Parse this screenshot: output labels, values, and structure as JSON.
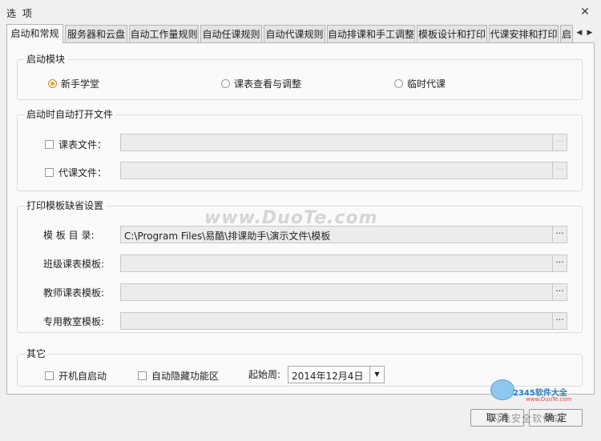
{
  "window": {
    "title": "选 项"
  },
  "tabs": [
    {
      "label": "启动和常规"
    },
    {
      "label": "服务器和云盘"
    },
    {
      "label": "自动工作量规则"
    },
    {
      "label": "自动任课规则"
    },
    {
      "label": "自动代课规则"
    },
    {
      "label": "自动排课和手工调整"
    },
    {
      "label": "模板设计和打印"
    },
    {
      "label": "代课安排和打印"
    },
    {
      "label": "启"
    }
  ],
  "startup": {
    "title": "启动模块",
    "options": [
      {
        "label": "新手学堂",
        "checked": true
      },
      {
        "label": "课表查看与调整",
        "checked": false
      },
      {
        "label": "临时代课",
        "checked": false
      }
    ]
  },
  "auto_open": {
    "title": "启动时自动打开文件",
    "rows": [
      {
        "label": "课表文件：",
        "checked": false,
        "value": ""
      },
      {
        "label": "代课文件：",
        "checked": false,
        "value": ""
      }
    ]
  },
  "print_templates": {
    "title": "打印模板缺省设置",
    "rows": [
      {
        "label": "模 板 目 录:",
        "value": "C:\\Program Files\\易酷\\排课助手\\演示文件\\模板"
      },
      {
        "label": "班级课表模板:",
        "value": ""
      },
      {
        "label": "教师课表模板:",
        "value": ""
      },
      {
        "label": "专用教室模板:",
        "value": ""
      }
    ]
  },
  "other": {
    "title": "其它",
    "autostart_label": "开机自启动",
    "autohide_label": "自动隐藏功能区",
    "start_week_label": "起始周:",
    "start_week_value": "2014年12月4日"
  },
  "buttons": {
    "cancel": "取 消",
    "ok": "确 定"
  },
  "watermarks": {
    "duote": "www.DuoTe.com",
    "site_2345": "2345软件大全",
    "site_2345_url": "www.DuoTe.com",
    "brand": "闪电安全软件站"
  },
  "colors": {
    "radio_accent": "#e8a040",
    "panel_bg": "#fafafa"
  }
}
